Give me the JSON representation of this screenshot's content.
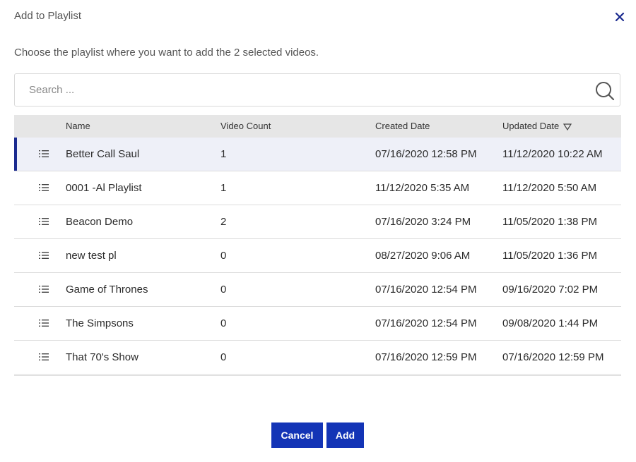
{
  "dialog": {
    "title": "Add to Playlist",
    "subtitle": "Choose the playlist where you want to add the 2 selected videos.",
    "close_icon": "close-icon"
  },
  "search": {
    "placeholder": "Search ...",
    "value": "",
    "icon": "search-icon"
  },
  "table": {
    "columns": [
      "Name",
      "Video Count",
      "Created Date",
      "Updated Date"
    ],
    "sort_column": "Updated Date",
    "sort_icon": "sort-down-triangle-icon",
    "row_icon": "list-icon",
    "selected_row": 0,
    "rows": [
      {
        "name": "Better Call Saul",
        "count": "1",
        "created": "07/16/2020 12:58 PM",
        "updated": "11/12/2020 10:22 AM"
      },
      {
        "name": "0001 -Al Playlist",
        "count": "1",
        "created": "11/12/2020 5:35 AM",
        "updated": "11/12/2020 5:50 AM"
      },
      {
        "name": "Beacon Demo",
        "count": "2",
        "created": "07/16/2020 3:24 PM",
        "updated": "11/05/2020 1:38 PM"
      },
      {
        "name": "new test pl",
        "count": "0",
        "created": "08/27/2020 9:06 AM",
        "updated": "11/05/2020 1:36 PM"
      },
      {
        "name": "Game of Thrones",
        "count": "0",
        "created": "07/16/2020 12:54 PM",
        "updated": "09/16/2020 7:02 PM"
      },
      {
        "name": "The Simpsons",
        "count": "0",
        "created": "07/16/2020 12:54 PM",
        "updated": "09/08/2020 1:44 PM"
      },
      {
        "name": "That 70's Show",
        "count": "0",
        "created": "07/16/2020 12:59 PM",
        "updated": "07/16/2020 12:59 PM"
      }
    ]
  },
  "buttons": {
    "cancel": "Cancel",
    "add": "Add"
  },
  "colors": {
    "accent": "#1334b6",
    "selected_bar": "#1a2a8f",
    "header_bg": "#e6e6e6",
    "selected_bg": "#eef0f8"
  }
}
